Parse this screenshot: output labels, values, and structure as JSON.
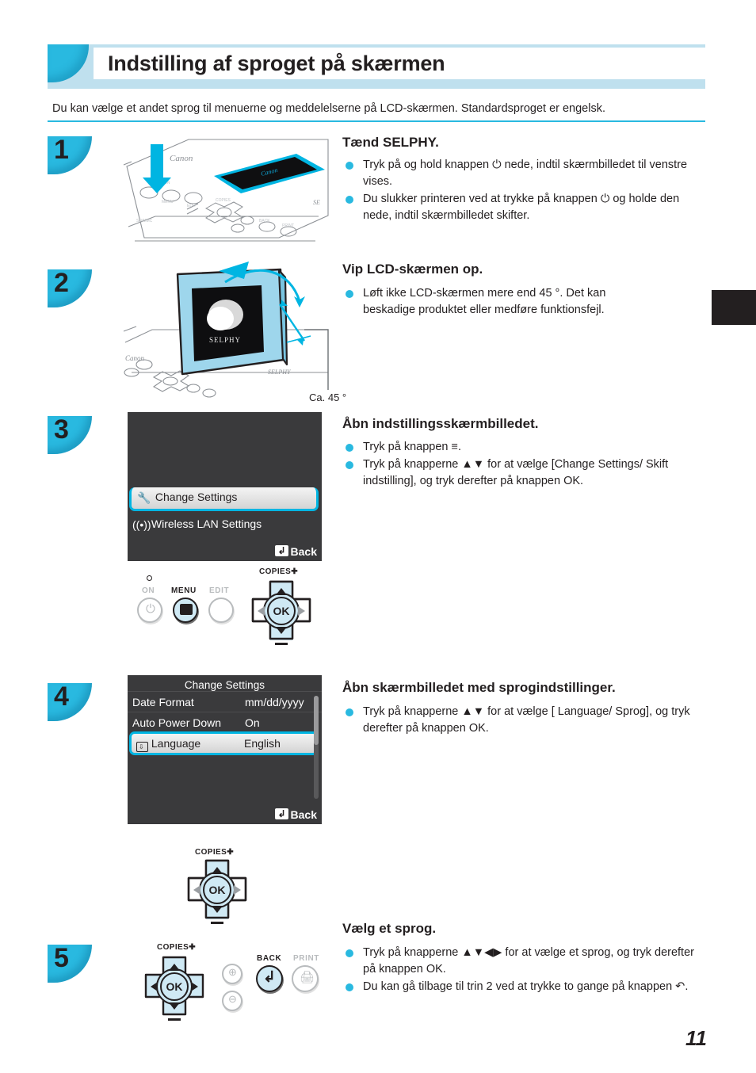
{
  "header": {
    "title": "Indstilling af sproget på skærmen",
    "intro": "Du kan vælge et andet sprog til menuerne og meddelelserne på LCD-skærmen. Standardsproget er engelsk.",
    "accent_color": "#29b9e0",
    "band_color": "#bfe0ee"
  },
  "steps": [
    {
      "number": "1",
      "heading": "Tænd SELPHY.",
      "bullets": [
        "Tryk på og hold knappen ⏻ nede, indtil skærmbilledet til venstre vises.",
        "Du slukker printeren ved at trykke på knappen ⏻ og holde den nede, indtil skærmbilledet skifter."
      ]
    },
    {
      "number": "2",
      "heading": "Vip LCD-skærmen op.",
      "bullets": [
        "Løft ikke LCD-skærmen mere end 45 °. Det kan beskadige produktet eller medføre funktionsfejl."
      ],
      "caption": "Ca. 45 °",
      "screen_logo": "SELPHY"
    },
    {
      "number": "3",
      "heading": "Åbn indstillingsskærmbilledet.",
      "bullets": [
        "Tryk på knappen ≡.",
        "Tryk på knapperne ▲▼ for at vælge [Change Settings/ Skift indstilling], og tryk derefter på knappen OK."
      ]
    },
    {
      "number": "4",
      "heading": "Åbn skærmbilledet med sprogindstillinger.",
      "bullets": [
        "Tryk på knapperne ▲▼ for at vælge [ Language/ Sprog], og tryk derefter på knappen OK."
      ]
    },
    {
      "number": "5",
      "heading": "Vælg et sprog.",
      "bullets": [
        "Tryk på knapperne ▲▼◀▶ for at vælge et sprog, og tryk derefter på knappen OK.",
        "Du kan gå tilbage til trin 2 ved at trykke to gange på knappen ↶."
      ]
    }
  ],
  "lcd_menu": {
    "items": [
      {
        "icon": "tools-icon",
        "label": "Change Settings",
        "selected": true
      },
      {
        "icon": "wireless-icon",
        "label": "Wireless LAN Settings",
        "selected": false
      }
    ],
    "back_label": "Back",
    "highlight_color": "#00b5e2",
    "background_color": "#3a3a3c"
  },
  "lcd_settings": {
    "title": "Change Settings",
    "rows": [
      {
        "label": "Date Format",
        "value": "mm/dd/yyyy",
        "selected": false
      },
      {
        "label": "Auto Power Down",
        "value": "On",
        "selected": false
      },
      {
        "label": "Language",
        "value": "English",
        "selected": true,
        "icon": "language-icon"
      }
    ],
    "back_label": "Back"
  },
  "buttons_step3": {
    "on_label": "ON",
    "menu_label": "MENU",
    "edit_label": "EDIT",
    "copies_label": "COPIES",
    "ok_label": "OK"
  },
  "buttons_step4": {
    "copies_label": "COPIES",
    "ok_label": "OK"
  },
  "buttons_step5": {
    "copies_label": "COPIES",
    "ok_label": "OK",
    "back_label": "BACK",
    "print_label": "PRINT"
  },
  "footer": {
    "page_number": "11"
  }
}
